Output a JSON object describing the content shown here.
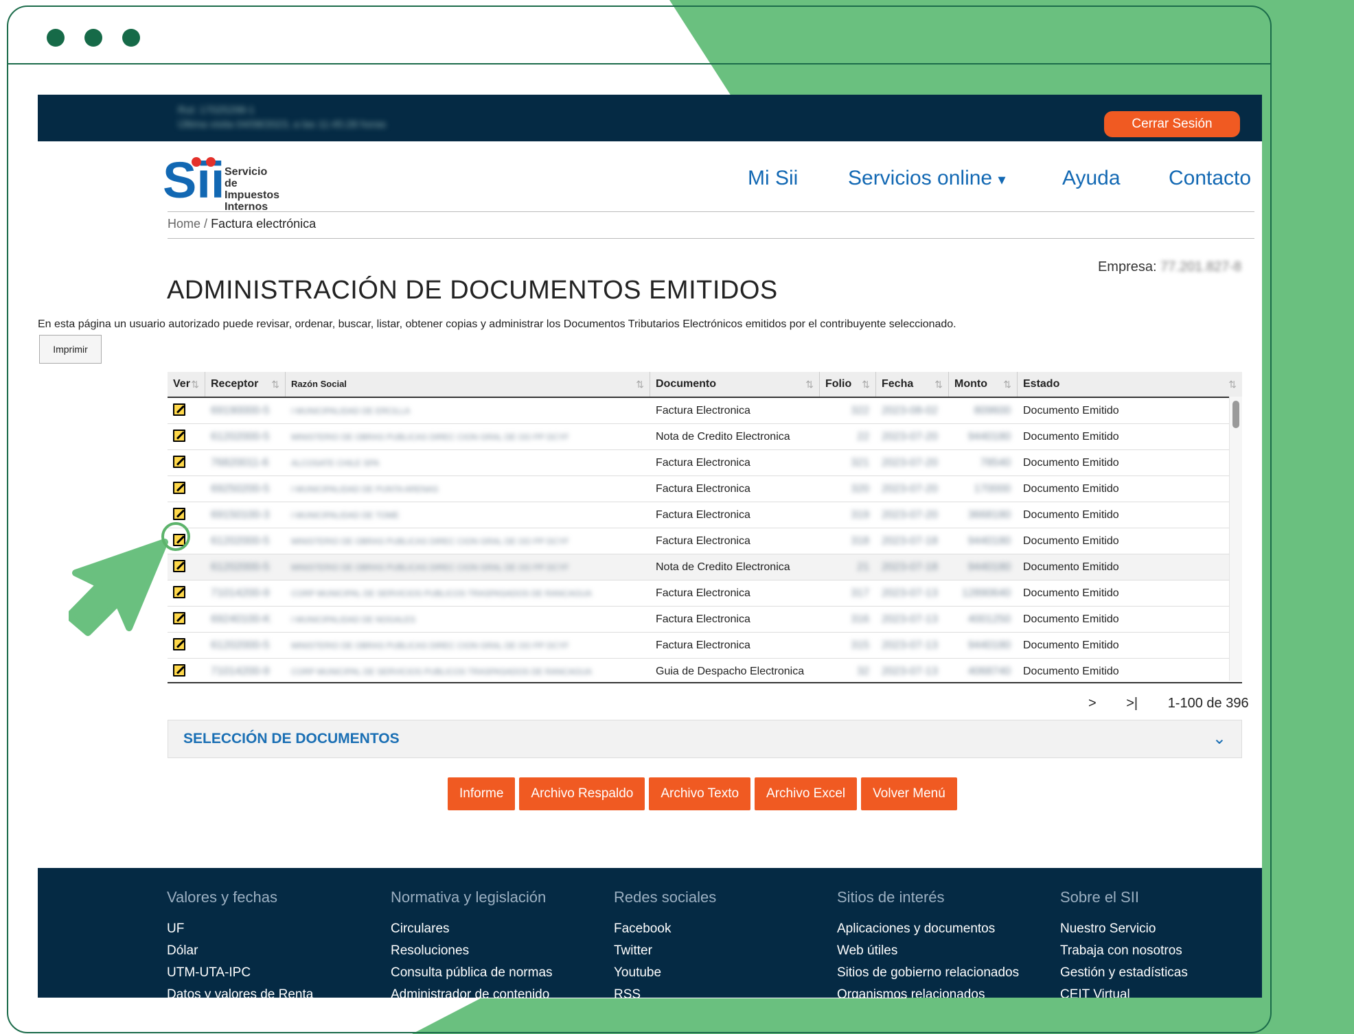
{
  "colors": {
    "accent_green": "#6ac07f",
    "frame_green": "#1b6b4a",
    "navy": "#052a44",
    "orange": "#f05a22",
    "link_blue": "#1268b3"
  },
  "topbar": {
    "visit_line1": "Rut: 17025298-1",
    "visit_line2": "Última visita 04/08/2023, a las 11:45:28 horas",
    "logout_label": "Cerrar Sesión"
  },
  "logo": {
    "mark": "Sii",
    "line1": "Servicio de",
    "line2": "Impuestos",
    "line3": "Internos"
  },
  "nav": {
    "items": [
      "Mi Sii",
      "Servicios online",
      "Ayuda",
      "Contacto"
    ]
  },
  "breadcrumb": {
    "home": "Home",
    "separator": "/",
    "current": "Factura electrónica"
  },
  "empresa": {
    "label": "Empresa:",
    "value": "77.201.827-8"
  },
  "page": {
    "title": "ADMINISTRACIÓN DE DOCUMENTOS EMITIDOS",
    "description": "En esta página un usuario autorizado puede revisar, ordenar, buscar, listar, obtener copias y administrar los Documentos Tributarios Electrónicos emitidos por el contribuyente seleccionado.",
    "print_label": "Imprimir"
  },
  "table": {
    "columns": [
      "Ver",
      "Receptor",
      "Razón Social",
      "Documento",
      "Folio",
      "Fecha",
      "Monto",
      "Estado"
    ],
    "rows": [
      {
        "receptor": "69190000-5",
        "razon": "I MUNICIPALIDAD DE ERCILLA",
        "documento": "Factura Electronica",
        "folio": "322",
        "fecha": "2023-08-02",
        "monto": "809600",
        "estado": "Documento Emitido"
      },
      {
        "receptor": "61202000-5",
        "razon": "MINISTERIO DE OBRAS PUBLICAS DIREC CION GRAL DE OO PP DCYF",
        "documento": "Nota de Credito Electronica",
        "folio": "22",
        "fecha": "2023-07-20",
        "monto": "9440180",
        "estado": "Documento Emitido"
      },
      {
        "receptor": "76820011-6",
        "razon": "ALCOSATE CHILE SPA",
        "documento": "Factura Electronica",
        "folio": "321",
        "fecha": "2023-07-20",
        "monto": "78540",
        "estado": "Documento Emitido"
      },
      {
        "receptor": "69250200-5",
        "razon": "I MUNICIPALIDAD DE PUNTA ARENAS",
        "documento": "Factura Electronica",
        "folio": "320",
        "fecha": "2023-07-20",
        "monto": "170000",
        "estado": "Documento Emitido"
      },
      {
        "receptor": "69150100-3",
        "razon": "I MUNICIPALIDAD DE TOME",
        "documento": "Factura Electronica",
        "folio": "319",
        "fecha": "2023-07-20",
        "monto": "3668180",
        "estado": "Documento Emitido"
      },
      {
        "receptor": "61202000-5",
        "razon": "MINISTERIO DE OBRAS PUBLICAS DIREC CION GRAL DE OO PP DCYF",
        "documento": "Factura Electronica",
        "folio": "318",
        "fecha": "2023-07-18",
        "monto": "9440180",
        "estado": "Documento Emitido"
      },
      {
        "receptor": "61202000-5",
        "razon": "MINISTERIO DE OBRAS PUBLICAS DIREC CION GRAL DE OO PP DCYF",
        "documento": "Nota de Credito Electronica",
        "folio": "21",
        "fecha": "2023-07-18",
        "monto": "9440180",
        "estado": "Documento Emitido"
      },
      {
        "receptor": "71014200-9",
        "razon": "CORP MUNICIPAL DE SERVICIOS PUBLICOS TRASPASADOS DE RANCAGUA",
        "documento": "Factura Electronica",
        "folio": "317",
        "fecha": "2023-07-13",
        "monto": "12890640",
        "estado": "Documento Emitido"
      },
      {
        "receptor": "69240100-K",
        "razon": "I MUNICIPALIDAD DE NOGALES",
        "documento": "Factura Electronica",
        "folio": "316",
        "fecha": "2023-07-13",
        "monto": "4001250",
        "estado": "Documento Emitido"
      },
      {
        "receptor": "61202000-5",
        "razon": "MINISTERIO DE OBRAS PUBLICAS DIREC CION GRAL DE OO PP DCYF",
        "documento": "Factura Electronica",
        "folio": "315",
        "fecha": "2023-07-13",
        "monto": "9440180",
        "estado": "Documento Emitido"
      },
      {
        "receptor": "71014200-9",
        "razon": "CORP MUNICIPAL DE SERVICIOS PUBLICOS TRASPASADOS DE RANCAGUA",
        "documento": "Guia de Despacho Electronica",
        "folio": "32",
        "fecha": "2023-07-13",
        "monto": "4068740",
        "estado": "Documento Emitido"
      }
    ]
  },
  "pager": {
    "next": ">",
    "last": ">|",
    "range": "1-100 de 396"
  },
  "section": {
    "label": "SELECCIÓN DE DOCUMENTOS"
  },
  "actions": [
    "Informe",
    "Archivo Respaldo",
    "Archivo Texto",
    "Archivo Excel",
    "Volver Menú"
  ],
  "footer": {
    "columns": [
      {
        "heading": "Valores y fechas",
        "items": [
          "UF",
          "Dólar",
          "UTM-UTA-IPC",
          "Datos y valores de Renta"
        ]
      },
      {
        "heading": "Normativa y legislación",
        "items": [
          "Circulares",
          "Resoluciones",
          "Consulta pública de normas",
          "Administrador de contenido"
        ]
      },
      {
        "heading": "Redes sociales",
        "items": [
          "Facebook",
          "Twitter",
          "Youtube",
          "RSS"
        ]
      },
      {
        "heading": "Sitios de interés",
        "items": [
          "Aplicaciones y documentos",
          "Web útiles",
          "Sitios de gobierno relacionados",
          "Organismos relacionados"
        ]
      },
      {
        "heading": "Sobre el SII",
        "items": [
          "Nuestro Servicio",
          "Trabaja con nosotros",
          "Gestión y estadísticas",
          "CEIT Virtual"
        ]
      }
    ]
  }
}
